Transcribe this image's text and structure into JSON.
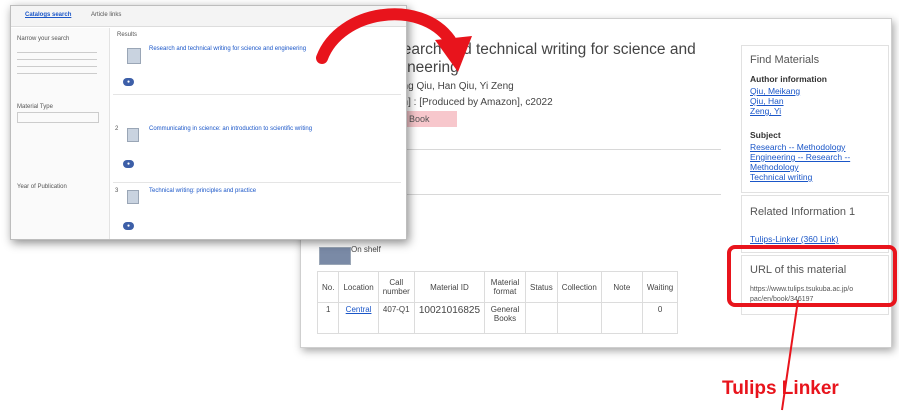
{
  "detail": {
    "title_line1": "search and technical writing for science and",
    "title_line2": "gineering",
    "authors": "ang Qiu, Han Qiu, Yi Zeng",
    "publisher": "an] : [Produced by Amazon], c2022",
    "material_type": "Book",
    "availability": "On shelf",
    "table": {
      "headers": [
        "No.",
        "Location",
        "Call number",
        "Material ID",
        "Material format",
        "Status",
        "Collection",
        "Note",
        "Waiting"
      ],
      "rows": [
        {
          "no": "1",
          "location": "Central",
          "call_number": "407-Q1",
          "material_id": "10021016825",
          "format": "General Books",
          "status": "",
          "collection": "",
          "note": "",
          "waiting": "0"
        }
      ]
    }
  },
  "sidebar": {
    "find_materials": "Find Materials",
    "author_info": "Author information",
    "authors": [
      "Qiu, Meikang",
      "Qiu, Han",
      "Zeng, Yi"
    ],
    "subject": "Subject",
    "subjects": [
      "Research -- Methodology",
      "Engineering -- Research --",
      "Methodology",
      "Technical writing"
    ],
    "related_info": "Related Information 1",
    "tulips_link": "Tulips-Linker (360 Link)",
    "url_heading": "URL of this material",
    "url_line1": "https://www.tulips.tsukuba.ac.jp/o",
    "url_line2": "pac/en/book/346197"
  },
  "search_results": {
    "tabs": [
      "Catalogs search",
      "Article links"
    ],
    "count": "Results",
    "left_filters": [
      "Narrow your search",
      "Material Type",
      "Year of Publication"
    ],
    "items": [
      {
        "num": "1",
        "title": "Research and technical writing for science and engineering"
      },
      {
        "num": "2",
        "title": "Communicating in science: an introduction to scientific writing"
      },
      {
        "num": "3",
        "title": "Technical writing: principles and practice"
      }
    ]
  },
  "annotation": {
    "label": "Tulips Linker"
  },
  "colors": {
    "accent_red": "#e8141c",
    "link_blue": "#1a56c8",
    "book_badge": "#f7c7cc"
  }
}
